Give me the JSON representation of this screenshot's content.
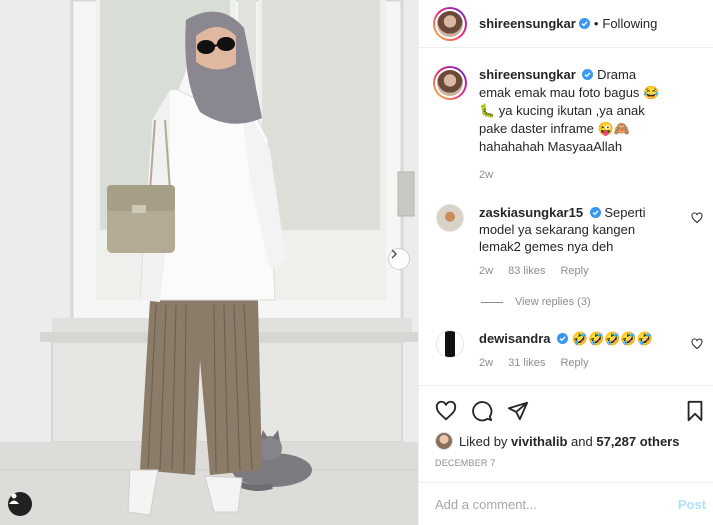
{
  "header": {
    "username": "shireensungkar",
    "separator": "•",
    "follow_status": "Following"
  },
  "caption": {
    "username": "shireensungkar",
    "text": "Drama emak emak mau foto bagus 😂🐛 ya kucing ikutan ,ya anak pake daster inframe 😜🙈 hahahahah MasyaaAllah",
    "age": "2w"
  },
  "comments": [
    {
      "username": "zaskiasungkar15",
      "text": "Seperti model ya sekarang kangen lemak2 gemes nya deh",
      "age": "2w",
      "likes": "83 likes",
      "reply": "Reply"
    },
    {
      "username": "dewisandra",
      "text": "🤣🤣🤣🤣🤣",
      "age": "2w",
      "likes": "31 likes",
      "reply": "Reply"
    }
  ],
  "view_replies": "View replies (3)",
  "liked_by": {
    "prefix": "Liked by",
    "user": "vivithalib",
    "and": "and",
    "others": "57,287 others"
  },
  "date": "DECEMBER 7",
  "comment_input": {
    "placeholder": "Add a comment...",
    "post_label": "Post"
  },
  "icons": [
    "verified-badge-icon",
    "heart-icon",
    "comment-icon",
    "share-icon",
    "bookmark-icon",
    "chevron-right-icon",
    "user-tag-icon"
  ],
  "colors": {
    "verified": "#3897f0",
    "post_disabled": "#b2dffc",
    "meta_gray": "#8e8e8e"
  }
}
